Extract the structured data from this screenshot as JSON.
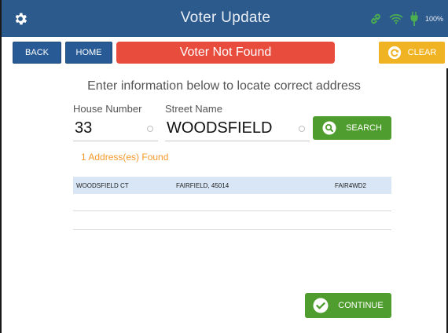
{
  "titlebar": {
    "title": "Voter Update",
    "battery_text": "100%",
    "icons": [
      "gear-icon",
      "link-icon",
      "wifi-icon",
      "plug-icon"
    ]
  },
  "nav": {
    "back_label": "BACK",
    "home_label": "HOME",
    "status_text": "Voter Not Found",
    "clear_label": "CLEAR"
  },
  "form": {
    "instructions": "Enter information below to locate correct address",
    "house_label": "House Number",
    "house_value": "33",
    "street_label": "Street Name",
    "street_value": "WOODSFIELD",
    "search_label": "SEARCH"
  },
  "results": {
    "count_text": "1 Address(es) Found",
    "rows": [
      {
        "street": "WOODSFIELD CT",
        "city": "FAIRFIELD, 45014",
        "code": "FAIR4WD2"
      }
    ]
  },
  "continue_label": "CONTINUE",
  "colors": {
    "header": "#2d5a8c",
    "nav_button": "#285b96",
    "error_banner": "#e84c3d",
    "clear_button": "#f0b323",
    "action_green": "#4f9d2e",
    "found_text": "#f39a2b",
    "selected_row": "#d8e6f5",
    "status_icons": "#4caf50"
  }
}
